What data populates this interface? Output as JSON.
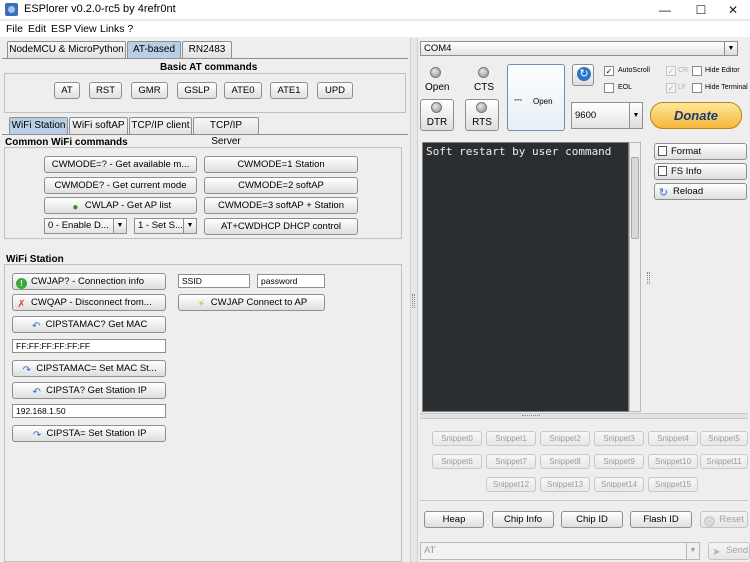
{
  "window": {
    "title": "ESPlorer v0.2.0-rc5 by 4refr0nt",
    "minimize": "—",
    "maximize": "☐",
    "close": "✕"
  },
  "menu": [
    "File",
    "Edit",
    "ESP",
    "View",
    "Links ?"
  ],
  "left": {
    "top_tabs": [
      "NodeMCU & MicroPython",
      "AT-based",
      "RN2483"
    ],
    "basic_title": "Basic AT commands",
    "basic_buttons": [
      "AT",
      "RST",
      "GMR",
      "GSLP",
      "ATE0",
      "ATE1",
      "UPD"
    ],
    "sub_tabs": [
      "WiFi Station",
      "WiFi softAP",
      "TCP/IP client",
      "TCP/IP Server"
    ],
    "common_title": "Common WiFi commands",
    "common": {
      "cwmode_q": "CWMODE=? - Get available m...",
      "cwmode1": "CWMODE=1 Station",
      "cwmode_cur": "CWMODE? - Get current mode",
      "cwmode2": "CWMODE=2 softAP",
      "cwlap": "CWLAP - Get AP list",
      "cwmode3": "CWMODE=3 softAP + Station",
      "combo1": "0 - Enable D...",
      "combo2": "1 - Set S...",
      "cwdhcp": "AT+CWDHCP  DHCP control"
    },
    "station_title": "WiFi Station",
    "station": {
      "cwjap_q": "CWJAP? - Connection info",
      "ssid": "SSID",
      "password": "password",
      "cwqap": "CWQAP - Disconnect from...",
      "cwjap": "CWJAP Connect to AP",
      "get_mac": "CIPSTAMAC? Get MAC",
      "mac_value": "FF:FF:FF:FF:FF:FF",
      "set_mac": "CIPSTAMAC= Set MAC St...",
      "get_ip": "CIPSTA? Get Station IP",
      "ip_value": "192.168.1.50",
      "set_ip": "CIPSTA= Set Station IP"
    }
  },
  "right": {
    "port": "COM4",
    "open_led": "Open",
    "cts": "CTS",
    "dtr": "DTR",
    "rts": "RTS",
    "open_button": "Open",
    "autoscroll": "AutoScroll",
    "eol": "EOL",
    "cr": "CR",
    "lf": "LF",
    "hide_editor": "Hide Editor",
    "hide_terminal": "Hide Terminal",
    "baud": "9600",
    "donate": "Donate",
    "terminal_text": "Soft restart by user command",
    "format": "Format",
    "fs_info": "FS Info",
    "reload": "Reload",
    "snippets": [
      "Snippet0",
      "Snippet1",
      "Snippet2",
      "Snippet3",
      "Snippet4",
      "Snippet5",
      "Snippet6",
      "Snippet7",
      "Snippet8",
      "Snippet9",
      "Snippet10",
      "Snippet11",
      "Snippet12",
      "Snippet13",
      "Snippet14",
      "Snippet15"
    ],
    "heap": "Heap",
    "chip_info": "Chip Info",
    "chip_id": "Chip ID",
    "flash_id": "Flash ID",
    "reset": "Reset",
    "cmd_value": "AT",
    "send": "Send"
  },
  "colors": {
    "accent_tab": "#b8cfe5",
    "terminal_bg": "#2b2e30",
    "donate": "#f6b73c"
  }
}
